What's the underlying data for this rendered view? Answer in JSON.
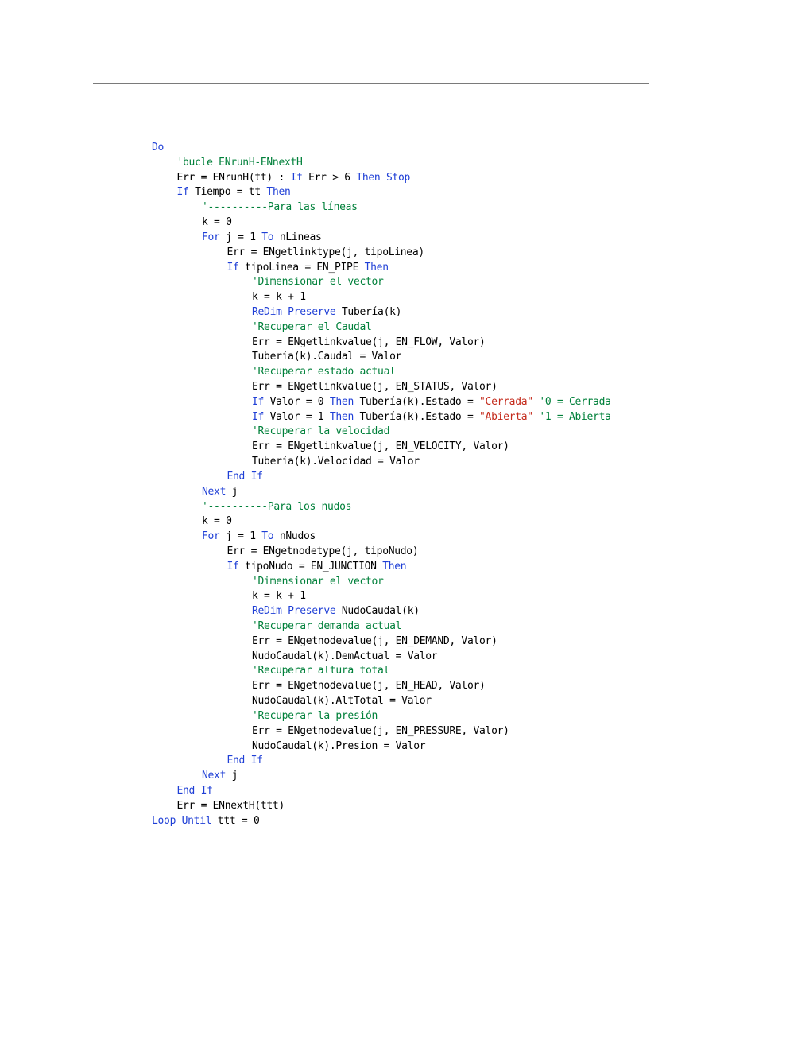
{
  "code_lines": [
    {
      "indent": 0,
      "segments": [
        {
          "t": "kw",
          "v": "Do"
        }
      ]
    },
    {
      "indent": 1,
      "segments": [
        {
          "t": "cm",
          "v": "'bucle ENrunH-ENnextH"
        }
      ]
    },
    {
      "indent": 1,
      "segments": [
        {
          "t": "tx",
          "v": "Err = ENrunH(tt) : "
        },
        {
          "t": "kw",
          "v": "If"
        },
        {
          "t": "tx",
          "v": " Err > 6 "
        },
        {
          "t": "kw",
          "v": "Then"
        },
        {
          "t": "tx",
          "v": " "
        },
        {
          "t": "kw",
          "v": "Stop"
        }
      ]
    },
    {
      "indent": 1,
      "segments": [
        {
          "t": "kw",
          "v": "If"
        },
        {
          "t": "tx",
          "v": " Tiempo = tt "
        },
        {
          "t": "kw",
          "v": "Then"
        }
      ]
    },
    {
      "indent": 2,
      "segments": [
        {
          "t": "cm",
          "v": "'----------Para las líneas"
        }
      ]
    },
    {
      "indent": 2,
      "segments": [
        {
          "t": "tx",
          "v": "k = 0"
        }
      ]
    },
    {
      "indent": 2,
      "segments": [
        {
          "t": "kw",
          "v": "For"
        },
        {
          "t": "tx",
          "v": " j = 1 "
        },
        {
          "t": "kw",
          "v": "To"
        },
        {
          "t": "tx",
          "v": " nLineas"
        }
      ]
    },
    {
      "indent": 3,
      "segments": [
        {
          "t": "tx",
          "v": "Err = ENgetlinktype(j, tipoLinea)"
        }
      ]
    },
    {
      "indent": 3,
      "segments": [
        {
          "t": "kw",
          "v": "If"
        },
        {
          "t": "tx",
          "v": " tipoLinea = EN_PIPE "
        },
        {
          "t": "kw",
          "v": "Then"
        }
      ]
    },
    {
      "indent": 4,
      "segments": [
        {
          "t": "cm",
          "v": "'Dimensionar el vector"
        }
      ]
    },
    {
      "indent": 4,
      "segments": [
        {
          "t": "tx",
          "v": "k = k + 1"
        }
      ]
    },
    {
      "indent": 4,
      "segments": [
        {
          "t": "kw",
          "v": "ReDim Preserve"
        },
        {
          "t": "tx",
          "v": " Tubería(k)"
        }
      ]
    },
    {
      "indent": 4,
      "segments": [
        {
          "t": "cm",
          "v": "'Recuperar el Caudal"
        }
      ]
    },
    {
      "indent": 4,
      "segments": [
        {
          "t": "tx",
          "v": "Err = ENgetlinkvalue(j, EN_FLOW, Valor)"
        }
      ]
    },
    {
      "indent": 4,
      "segments": [
        {
          "t": "tx",
          "v": "Tubería(k).Caudal = Valor"
        }
      ]
    },
    {
      "indent": 4,
      "segments": [
        {
          "t": "cm",
          "v": "'Recuperar estado actual"
        }
      ]
    },
    {
      "indent": 4,
      "segments": [
        {
          "t": "tx",
          "v": "Err = ENgetlinkvalue(j, EN_STATUS, Valor)"
        }
      ]
    },
    {
      "indent": 4,
      "segments": [
        {
          "t": "kw",
          "v": "If"
        },
        {
          "t": "tx",
          "v": " Valor = 0 "
        },
        {
          "t": "kw",
          "v": "Then"
        },
        {
          "t": "tx",
          "v": " Tubería(k).Estado = "
        },
        {
          "t": "st",
          "v": "\"Cerrada\""
        },
        {
          "t": "tx",
          "v": " "
        },
        {
          "t": "cm",
          "v": "'0 = Cerrada"
        }
      ]
    },
    {
      "indent": 4,
      "segments": [
        {
          "t": "kw",
          "v": "If"
        },
        {
          "t": "tx",
          "v": " Valor = 1 "
        },
        {
          "t": "kw",
          "v": "Then"
        },
        {
          "t": "tx",
          "v": " Tubería(k).Estado = "
        },
        {
          "t": "st",
          "v": "\"Abierta\""
        },
        {
          "t": "tx",
          "v": " "
        },
        {
          "t": "cm",
          "v": "'1 = Abierta"
        }
      ]
    },
    {
      "indent": 4,
      "segments": [
        {
          "t": "cm",
          "v": "'Recuperar la velocidad"
        }
      ]
    },
    {
      "indent": 4,
      "segments": [
        {
          "t": "tx",
          "v": "Err = ENgetlinkvalue(j, EN_VELOCITY, Valor)"
        }
      ]
    },
    {
      "indent": 4,
      "segments": [
        {
          "t": "tx",
          "v": "Tubería(k).Velocidad = Valor"
        }
      ]
    },
    {
      "indent": 3,
      "segments": [
        {
          "t": "kw",
          "v": "End If"
        }
      ]
    },
    {
      "indent": 2,
      "segments": [
        {
          "t": "kw",
          "v": "Next"
        },
        {
          "t": "tx",
          "v": " j"
        }
      ]
    },
    {
      "indent": 2,
      "segments": [
        {
          "t": "cm",
          "v": "'----------Para los nudos"
        }
      ]
    },
    {
      "indent": 2,
      "segments": [
        {
          "t": "tx",
          "v": "k = 0"
        }
      ]
    },
    {
      "indent": 2,
      "segments": [
        {
          "t": "kw",
          "v": "For"
        },
        {
          "t": "tx",
          "v": " j = 1 "
        },
        {
          "t": "kw",
          "v": "To"
        },
        {
          "t": "tx",
          "v": " nNudos"
        }
      ]
    },
    {
      "indent": 3,
      "segments": [
        {
          "t": "tx",
          "v": "Err = ENgetnodetype(j, tipoNudo)"
        }
      ]
    },
    {
      "indent": 3,
      "segments": [
        {
          "t": "kw",
          "v": "If"
        },
        {
          "t": "tx",
          "v": " tipoNudo = EN_JUNCTION "
        },
        {
          "t": "kw",
          "v": "Then"
        }
      ]
    },
    {
      "indent": 4,
      "segments": [
        {
          "t": "cm",
          "v": "'Dimensionar el vector"
        }
      ]
    },
    {
      "indent": 4,
      "segments": [
        {
          "t": "tx",
          "v": "k = k + 1"
        }
      ]
    },
    {
      "indent": 4,
      "segments": [
        {
          "t": "kw",
          "v": "ReDim Preserve"
        },
        {
          "t": "tx",
          "v": " NudoCaudal(k)"
        }
      ]
    },
    {
      "indent": 4,
      "segments": [
        {
          "t": "cm",
          "v": "'Recuperar demanda actual"
        }
      ]
    },
    {
      "indent": 4,
      "segments": [
        {
          "t": "tx",
          "v": "Err = ENgetnodevalue(j, EN_DEMAND, Valor)"
        }
      ]
    },
    {
      "indent": 4,
      "segments": [
        {
          "t": "tx",
          "v": "NudoCaudal(k).DemActual = Valor"
        }
      ]
    },
    {
      "indent": 4,
      "segments": [
        {
          "t": "cm",
          "v": "'Recuperar altura total"
        }
      ]
    },
    {
      "indent": 4,
      "segments": [
        {
          "t": "tx",
          "v": "Err = ENgetnodevalue(j, EN_HEAD, Valor)"
        }
      ]
    },
    {
      "indent": 4,
      "segments": [
        {
          "t": "tx",
          "v": "NudoCaudal(k).AltTotal = Valor"
        }
      ]
    },
    {
      "indent": 4,
      "segments": [
        {
          "t": "cm",
          "v": "'Recuperar la presión"
        }
      ]
    },
    {
      "indent": 4,
      "segments": [
        {
          "t": "tx",
          "v": "Err = ENgetnodevalue(j, EN_PRESSURE, Valor)"
        }
      ]
    },
    {
      "indent": 4,
      "segments": [
        {
          "t": "tx",
          "v": "NudoCaudal(k).Presion = Valor"
        }
      ]
    },
    {
      "indent": 3,
      "segments": [
        {
          "t": "kw",
          "v": "End If"
        }
      ]
    },
    {
      "indent": 2,
      "segments": [
        {
          "t": "kw",
          "v": "Next"
        },
        {
          "t": "tx",
          "v": " j"
        }
      ]
    },
    {
      "indent": 1,
      "segments": [
        {
          "t": "kw",
          "v": "End If"
        }
      ]
    },
    {
      "indent": 1,
      "segments": [
        {
          "t": "tx",
          "v": "Err = ENnextH(ttt)"
        }
      ]
    },
    {
      "indent": 0,
      "segments": [
        {
          "t": "kw",
          "v": "Loop Until"
        },
        {
          "t": "tx",
          "v": " ttt = 0"
        }
      ]
    }
  ],
  "colors": {
    "keyword": "#1f3fd6",
    "comment": "#00803a",
    "string": "#c42b1c",
    "text": "#000000"
  }
}
